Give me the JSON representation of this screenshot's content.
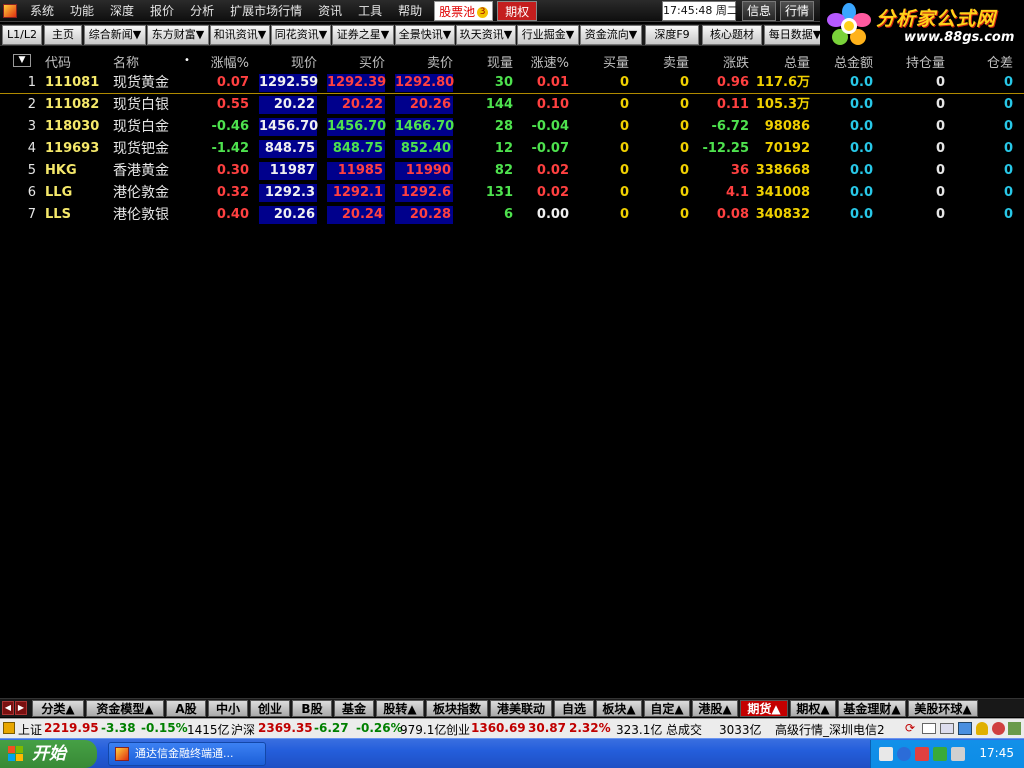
{
  "menu": {
    "items": [
      "系统",
      "功能",
      "深度",
      "报价",
      "分析",
      "扩展市场行情",
      "资讯",
      "工具",
      "帮助"
    ],
    "stock_pool": "股票池",
    "stock_pool_badge": "3",
    "options": "期权",
    "clock": "17:45:48 周二",
    "info_btn": "信息",
    "quote_btn": "行情"
  },
  "logo": {
    "title": "分析家公式网",
    "url": "www.88gs.com"
  },
  "toolbar": {
    "level": "L1/L2",
    "home": "主页",
    "buttons": [
      "综合新闻▼",
      "东方财富▼",
      "和讯资讯▼",
      "同花资讯▼",
      "证券之星▼",
      "全景快讯▼",
      "玖天资讯▼",
      "行业掘金▼",
      "资金流向▼"
    ],
    "depth": "深度F9",
    "core": "核心题材",
    "daily": "每日数据▼"
  },
  "columns": {
    "sort": "▼",
    "code": "代码",
    "name": "名称",
    "dot": "•",
    "chg_pct": "涨幅%",
    "price": "现价",
    "bid": "买价",
    "ask": "卖价",
    "vol": "现量",
    "speed": "涨速%",
    "bid_vol": "买量",
    "ask_vol": "卖量",
    "updown": "涨跌",
    "total": "总量",
    "amount": "总金额",
    "oi": "持仓量",
    "oi_diff": "仓差"
  },
  "rows": [
    {
      "idx": "1",
      "code": "111081",
      "name": "现货黄金",
      "chg": "0.07",
      "price": "1292.59",
      "bid": "1292.39",
      "ask": "1292.80",
      "vol": "30",
      "speed": "0.01",
      "bvol": "0",
      "svol": "0",
      "updown": "0.96",
      "total": "117.6万",
      "amt": "0.0",
      "oi": "0",
      "oidiff": "0",
      "dir": "up",
      "speed_dir": "up",
      "quote_color": "white"
    },
    {
      "idx": "2",
      "code": "111082",
      "name": "现货白银",
      "chg": "0.55",
      "price": "20.22",
      "bid": "20.22",
      "ask": "20.26",
      "vol": "144",
      "speed": "0.10",
      "bvol": "0",
      "svol": "0",
      "updown": "0.11",
      "total": "105.3万",
      "amt": "0.0",
      "oi": "0",
      "oidiff": "0",
      "dir": "up",
      "speed_dir": "up",
      "quote_color": "white"
    },
    {
      "idx": "3",
      "code": "118030",
      "name": "现货白金",
      "chg": "-0.46",
      "price": "1456.70",
      "bid": "1456.70",
      "ask": "1466.70",
      "vol": "28",
      "speed": "-0.04",
      "bvol": "0",
      "svol": "0",
      "updown": "-6.72",
      "total": "98086",
      "amt": "0.0",
      "oi": "0",
      "oidiff": "0",
      "dir": "down",
      "speed_dir": "down",
      "quote_color": "white"
    },
    {
      "idx": "4",
      "code": "119693",
      "name": "现货钯金",
      "chg": "-1.42",
      "price": "848.75",
      "bid": "848.75",
      "ask": "852.40",
      "vol": "12",
      "speed": "-0.07",
      "bvol": "0",
      "svol": "0",
      "updown": "-12.25",
      "total": "70192",
      "amt": "0.0",
      "oi": "0",
      "oidiff": "0",
      "dir": "down",
      "speed_dir": "down",
      "quote_color": "white"
    },
    {
      "idx": "5",
      "code": "HKG",
      "name": "香港黄金",
      "chg": "0.30",
      "price": "11987",
      "bid": "11985",
      "ask": "11990",
      "vol": "82",
      "speed": "0.02",
      "bvol": "0",
      "svol": "0",
      "updown": "36",
      "total": "338668",
      "amt": "0.0",
      "oi": "0",
      "oidiff": "0",
      "dir": "up",
      "speed_dir": "up",
      "quote_color": "white"
    },
    {
      "idx": "6",
      "code": "LLG",
      "name": "港伦敦金",
      "chg": "0.32",
      "price": "1292.3",
      "bid": "1292.1",
      "ask": "1292.6",
      "vol": "131",
      "speed": "0.02",
      "bvol": "0",
      "svol": "0",
      "updown": "4.1",
      "total": "341008",
      "amt": "0.0",
      "oi": "0",
      "oidiff": "0",
      "dir": "up",
      "speed_dir": "up",
      "quote_color": "white"
    },
    {
      "idx": "7",
      "code": "LLS",
      "name": "港伦敦银",
      "chg": "0.40",
      "price": "20.26",
      "bid": "20.24",
      "ask": "20.28",
      "vol": "6",
      "speed": "0.00",
      "bvol": "0",
      "svol": "0",
      "updown": "0.08",
      "total": "340832",
      "amt": "0.0",
      "oi": "0",
      "oidiff": "0",
      "dir": "up",
      "speed_dir": "flat",
      "quote_color": "white"
    }
  ],
  "market_tabs": [
    "分类▲",
    "资金模型▲",
    "A股",
    "中小",
    "创业",
    "B股",
    "基金",
    "股转▲",
    "板块指数",
    "港美联动",
    "自选",
    "板块▲",
    "自定▲",
    "港股▲",
    "期货▲",
    "期权▲",
    "基金理财▲",
    "美股环球▲"
  ],
  "active_market_tab": "期货▲",
  "status": {
    "sh_label": "上证",
    "sh_val": "2219.95",
    "sh_chg": "-3.38",
    "sh_pct": "-0.15%",
    "sh_amt": "1415亿",
    "hs_label": "沪深",
    "hs_val": "2369.35",
    "hs_chg": "-6.27",
    "hs_pct": "-0.26%",
    "hs_amt": "979.1亿",
    "cy_label": "创业",
    "cy_val": "1360.69",
    "cy_chg": "30.87",
    "cy_pct": "2.32%",
    "cy_amt": "323.1亿",
    "total_label": "总成交",
    "total_val": "3033亿",
    "server": "高级行情_深圳电信2"
  },
  "taskbar": {
    "start": "开始",
    "app": "通达信金融终端通...",
    "clock": "17:45"
  },
  "colors": {
    "up": "#ff4040",
    "down": "#4ee24e",
    "flat": "#f0f0f0",
    "quote_bg": "#00008c",
    "code": "#f5e86a",
    "cyan": "#28c8e8",
    "yellow": "#f0d000"
  }
}
